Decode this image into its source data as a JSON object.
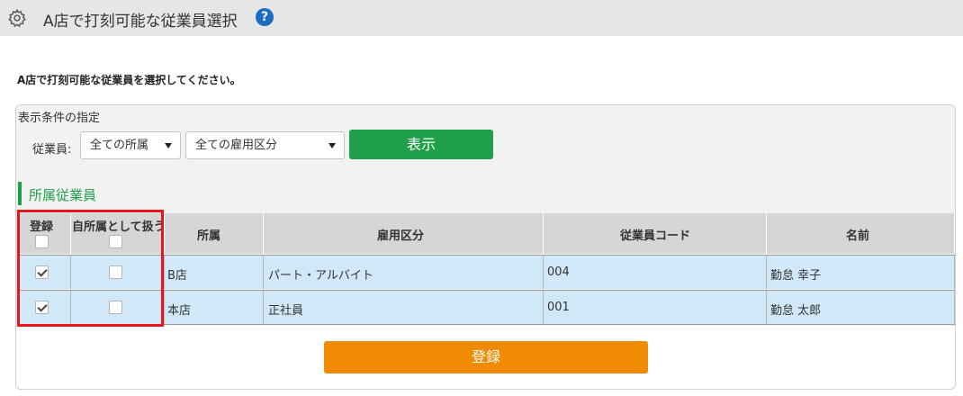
{
  "header": {
    "title": "A店で打刻可能な従業員選択",
    "settings_icon": "gear-icon",
    "help_icon": "question-circle-icon",
    "help_symbol": "?",
    "help_color": "#1a6ec2"
  },
  "instruction": "A店で打刻可能な従業員を選択してください。",
  "filter": {
    "section_label": "表示条件の指定",
    "employee_label": "従業員:",
    "dept_select": "全ての所属",
    "employment_select": "全ての雇用区分",
    "show_button": "表示",
    "show_button_color": "#20a04a"
  },
  "section": {
    "title": "所属従業員",
    "accent_color": "#1fa04a"
  },
  "table": {
    "columns": {
      "register": "登録",
      "own_dept": "自所属として扱う",
      "dept": "所属",
      "employment_type": "雇用区分",
      "employee_code": "従業員コード",
      "name": "名前"
    },
    "header_checkboxes": {
      "register": false,
      "own_dept": false
    },
    "rows": [
      {
        "register": true,
        "own_dept": false,
        "dept": "B店",
        "employment_type": "パート・アルバイト",
        "employee_code": "004",
        "name": "勤怠 幸子"
      },
      {
        "register": true,
        "own_dept": false,
        "dept": "本店",
        "employment_type": "正社員",
        "employee_code": "001",
        "name": "勤怠 太郎"
      }
    ],
    "row_color": "#d1e8f8",
    "highlight_color": "#e8141c"
  },
  "register_button": {
    "label": "登録",
    "color": "#f08a00"
  }
}
